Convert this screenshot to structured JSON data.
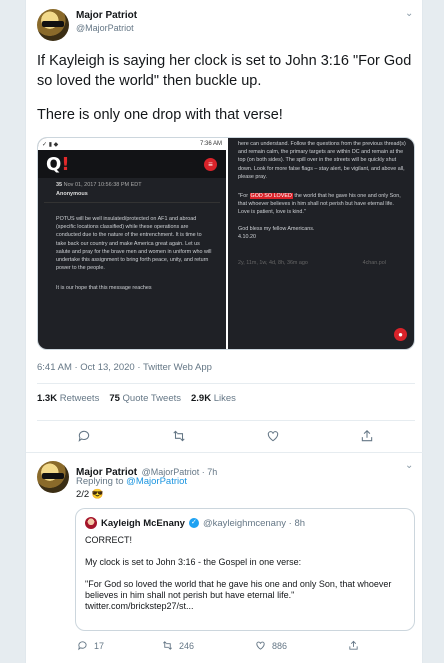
{
  "main_tweet": {
    "name": "Major Patriot",
    "handle": "@MajorPatriot",
    "text_line1": "If Kayleigh is saying her clock is set to John 3:16 \"For God",
    "text_line2": "so loved the world\" then buckle up.",
    "text_line3": "There is only one drop with that verse!",
    "timestamp": "6:41 AM · Oct 13, 2020 · Twitter Web App",
    "retweets_count": "1.3K",
    "retweets_label": "Retweets",
    "quotes_count": "75",
    "quotes_label": "Quote Tweets",
    "likes_count": "2.9K",
    "likes_label": "Likes"
  },
  "media": {
    "status_time": "7:36 AM",
    "post_meta_num": "35",
    "post_meta_date": "Nov 01, 2017 10:56:38 PM EDT",
    "post_author": "Anonymous",
    "left_paragraph": "POTUS will be well insulated/protected on AF1 and abroad (specific locations classified) while these operations are conducted due to the nature of the entrenchment. It is time to take back our country and make America great again. Let us salute and pray for the brave men and women in uniform who will undertake this assignment to bring forth peace, unity, and return power to the people.",
    "left_footer": "It is our hope that this message reaches",
    "right_para1": "here can understand. Follow the questions from the previous thread(s) and remain calm, the primary targets are within DC and remain at the top (on both sides). The spill over in the streets will be quickly shut down. Look for more false flags – stay alert, be vigilant, and above all, please pray.",
    "right_quote_pre": "\"For",
    "right_quote_hl": "GOD SO LOVED",
    "right_quote_post": "the world that he gave his one and only Son, that whoever believes in him shall not perish but have eternal life. Love is patient, love is kind.\"",
    "right_bless": "God bless my fellow Americans.",
    "right_ref": "4.10.20",
    "right_footer": "2y, 11m, 1w, 4d, 8h, 36m ago",
    "right_footer_link": "4chan.pol"
  },
  "reply_tweet": {
    "name": "Major Patriot",
    "handle_time": "@MajorPatriot · 7h",
    "replying_prefix": "Replying to",
    "replying_to": "@MajorPatriot",
    "text": "2/2 😎",
    "reply_count": "17",
    "retweet_count": "246",
    "like_count": "886"
  },
  "quoted_tweet": {
    "name": "Kayleigh McEnany",
    "handle_time": "@kayleighmcenany · 8h",
    "line1": "CORRECT!",
    "line2": "My clock is set to John 3:16 - the Gospel in one verse:",
    "line3": "\"For God so loved the world that he gave his one and only Son, that whoever believes in him shall not perish but have eternal life.\"",
    "line4": "twitter.com/brickstep27/st..."
  },
  "icons": {
    "reply": "reply-icon",
    "retweet": "retweet-icon",
    "like": "like-icon",
    "share": "share-icon",
    "chevron": "chevron-down-icon",
    "verified": "verified-icon"
  },
  "colors": {
    "link": "#1b95e0",
    "verified": "#1da1f2",
    "muted": "#657786",
    "q_red": "#d9232a"
  }
}
